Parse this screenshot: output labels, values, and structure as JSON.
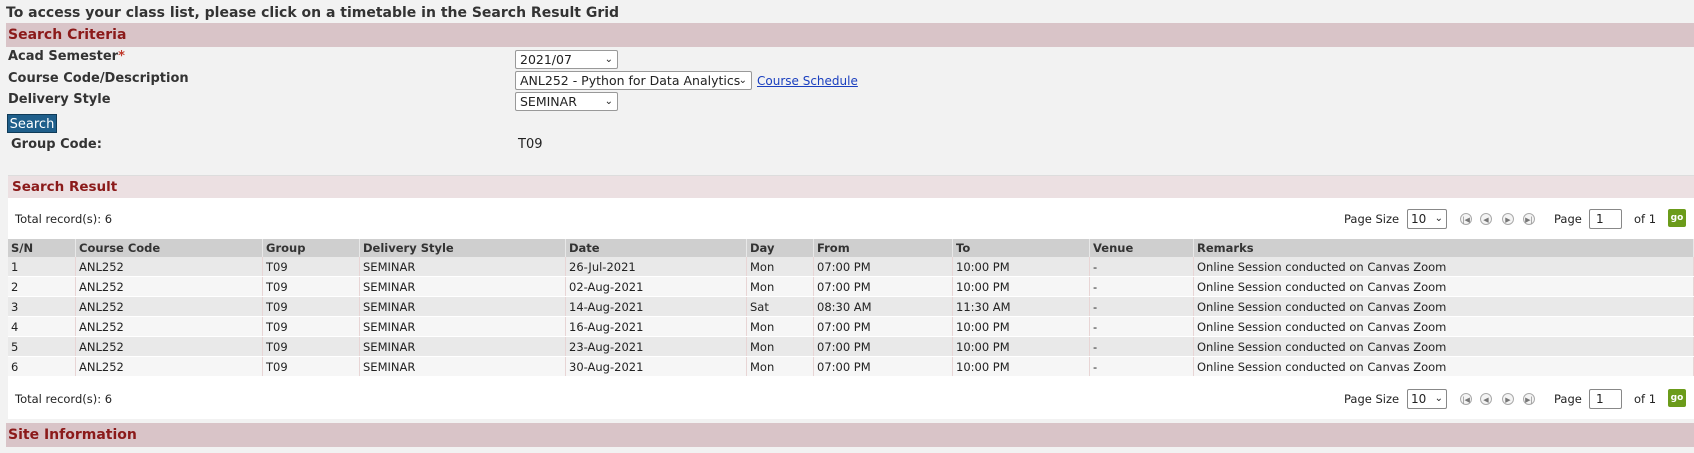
{
  "instruction": "To access your class list, please click on a timetable in the Search Result Grid",
  "search_criteria": {
    "title": "Search Criteria",
    "acad_semester": {
      "label": "Acad Semester",
      "required_mark": "*",
      "value": "2021/07"
    },
    "course": {
      "label": "Course Code/Description",
      "value": "ANL252 - Python for Data Analytics",
      "link": "Course Schedule"
    },
    "delivery_style": {
      "label": "Delivery Style",
      "value": "SEMINAR"
    },
    "search_button": "Search",
    "group_code": {
      "label": "Group Code:",
      "value": "T09"
    }
  },
  "search_result": {
    "title": "Search Result",
    "pager": {
      "total": "Total record(s): 6",
      "page_size_label": "Page Size",
      "page_size": "10",
      "page_label": "Page",
      "page": "1",
      "of": "of 1",
      "go": "go"
    },
    "columns": [
      "S/N",
      "Course Code",
      "Group",
      "Delivery Style",
      "Date",
      "Day",
      "From",
      "To",
      "Venue",
      "Remarks"
    ],
    "rows": [
      [
        "1",
        "ANL252",
        "T09",
        "SEMINAR",
        "26-Jul-2021",
        "Mon",
        "07:00 PM",
        "10:00 PM",
        "-",
        "Online Session conducted on Canvas Zoom"
      ],
      [
        "2",
        "ANL252",
        "T09",
        "SEMINAR",
        "02-Aug-2021",
        "Mon",
        "07:00 PM",
        "10:00 PM",
        "-",
        "Online Session conducted on Canvas Zoom"
      ],
      [
        "3",
        "ANL252",
        "T09",
        "SEMINAR",
        "14-Aug-2021",
        "Sat",
        "08:30 AM",
        "11:30 AM",
        "-",
        "Online Session conducted on Canvas Zoom"
      ],
      [
        "4",
        "ANL252",
        "T09",
        "SEMINAR",
        "16-Aug-2021",
        "Mon",
        "07:00 PM",
        "10:00 PM",
        "-",
        "Online Session conducted on Canvas Zoom"
      ],
      [
        "5",
        "ANL252",
        "T09",
        "SEMINAR",
        "23-Aug-2021",
        "Mon",
        "07:00 PM",
        "10:00 PM",
        "-",
        "Online Session conducted on Canvas Zoom"
      ],
      [
        "6",
        "ANL252",
        "T09",
        "SEMINAR",
        "30-Aug-2021",
        "Mon",
        "07:00 PM",
        "10:00 PM",
        "-",
        "Online Session conducted on Canvas Zoom"
      ]
    ]
  },
  "site_information": "Site Information",
  "icons": {
    "first": "first-page-icon",
    "prev": "prev-page-icon",
    "next": "next-page-icon",
    "last": "last-page-icon",
    "dropdown": "chevron-down-icon"
  }
}
